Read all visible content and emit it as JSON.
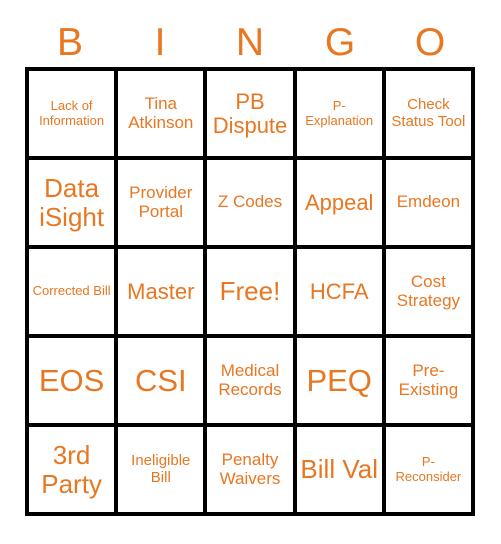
{
  "card": {
    "title_letters": [
      "B",
      "I",
      "N",
      "G",
      "O"
    ],
    "accent_color": "#E87722",
    "border_color": "#000000",
    "background_color": "#FFFFFF",
    "columns": 5,
    "rows": 5,
    "cells": [
      {
        "text": "Lack of Information",
        "size": "xs",
        "column": "B",
        "row": 1
      },
      {
        "text": "Tina Atkinson",
        "size": "md",
        "column": "I",
        "row": 1
      },
      {
        "text": "PB Dispute",
        "size": "lg",
        "column": "N",
        "row": 1
      },
      {
        "text": "P- Explanation",
        "size": "xs",
        "column": "G",
        "row": 1
      },
      {
        "text": "Check Status Tool",
        "size": "sm",
        "column": "O",
        "row": 1
      },
      {
        "text": "Data iSight",
        "size": "xl",
        "column": "B",
        "row": 2
      },
      {
        "text": "Provider Portal",
        "size": "md",
        "column": "I",
        "row": 2
      },
      {
        "text": "Z Codes",
        "size": "md",
        "column": "N",
        "row": 2
      },
      {
        "text": "Appeal",
        "size": "lg",
        "column": "G",
        "row": 2
      },
      {
        "text": "Emdeon",
        "size": "md",
        "column": "O",
        "row": 2
      },
      {
        "text": "Corrected Bill",
        "size": "xs",
        "column": "B",
        "row": 3
      },
      {
        "text": "Master",
        "size": "lg",
        "column": "I",
        "row": 3
      },
      {
        "text": "Free!",
        "size": "xl",
        "column": "N",
        "row": 3
      },
      {
        "text": "HCFA",
        "size": "lg",
        "column": "G",
        "row": 3
      },
      {
        "text": "Cost Strategy",
        "size": "md",
        "column": "O",
        "row": 3
      },
      {
        "text": "EOS",
        "size": "xxl",
        "column": "B",
        "row": 4
      },
      {
        "text": "CSI",
        "size": "xxl",
        "column": "I",
        "row": 4
      },
      {
        "text": "Medical Records",
        "size": "md",
        "column": "N",
        "row": 4
      },
      {
        "text": "PEQ",
        "size": "xxl",
        "column": "G",
        "row": 4
      },
      {
        "text": "Pre- Existing",
        "size": "md",
        "column": "O",
        "row": 4
      },
      {
        "text": "3rd Party",
        "size": "xl",
        "column": "B",
        "row": 5
      },
      {
        "text": "Ineligible Bill",
        "size": "sm",
        "column": "I",
        "row": 5
      },
      {
        "text": "Penalty Waivers",
        "size": "md",
        "column": "N",
        "row": 5
      },
      {
        "text": "Bill Val",
        "size": "xl",
        "column": "G",
        "row": 5
      },
      {
        "text": "P- Reconsider",
        "size": "xs",
        "column": "O",
        "row": 5
      }
    ]
  }
}
